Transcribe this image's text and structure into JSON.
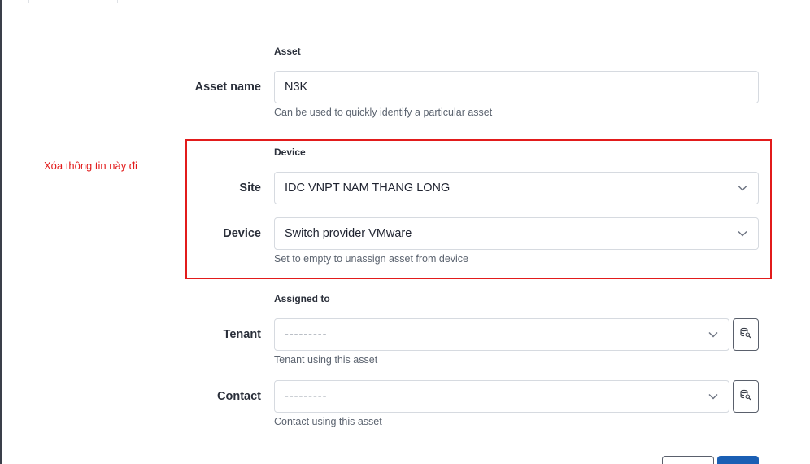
{
  "annotation": "Xóa thông tin này đi",
  "asset_section": {
    "heading": "Asset",
    "asset_name_label": "Asset name",
    "asset_name_value": "N3K",
    "asset_name_help": "Can be used to quickly identify a particular asset"
  },
  "device_section": {
    "heading": "Device",
    "site_label": "Site",
    "site_value": "IDC VNPT NAM THANG LONG",
    "device_label": "Device",
    "device_value": "Switch provider VMware",
    "device_help": "Set to empty to unassign asset from device"
  },
  "assigned_section": {
    "heading": "Assigned to",
    "tenant_label": "Tenant",
    "tenant_placeholder": "---------",
    "tenant_help": "Tenant using this asset",
    "contact_label": "Contact",
    "contact_placeholder": "---------",
    "contact_help": "Contact using this asset"
  },
  "icons": {
    "select_chevron": "chevron-down-icon",
    "selector_button": "selector-search-icon"
  },
  "colors": {
    "annotation_red": "#e21b1b",
    "primary": "#1a5fb4"
  }
}
